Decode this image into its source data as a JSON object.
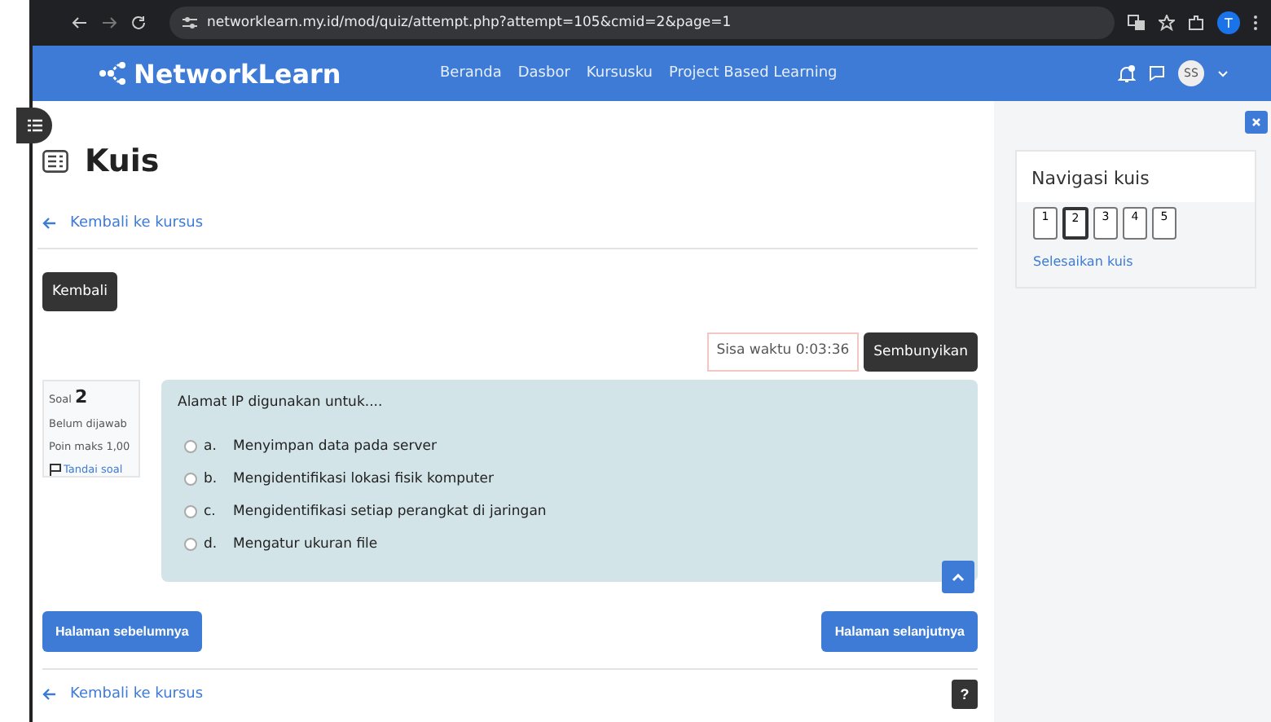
{
  "browser": {
    "url": "networklearn.my.id/mod/quiz/attempt.php?attempt=105&cmid=2&page=1",
    "profile": "T"
  },
  "navbar": {
    "brand": "NetworkLearn",
    "links": [
      "Beranda",
      "Dasbor",
      "Kursusku",
      "Project Based Learning"
    ],
    "avatar": "SS"
  },
  "page": {
    "title": "Kuis",
    "back_link": "Kembali ke kursus",
    "back_button": "Kembali",
    "timer": "Sisa waktu 0:03:36",
    "hide_button": "Sembunyikan"
  },
  "question": {
    "label": "Soal",
    "number": "2",
    "status": "Belum dijawab",
    "points": "Poin maks 1,00",
    "flag": "Tandai soal",
    "text": "Alamat IP digunakan untuk....",
    "options": [
      {
        "letter": "a.",
        "text": "Menyimpan data pada server",
        "selected": false
      },
      {
        "letter": "b.",
        "text": "Mengidentifikasi lokasi fisik komputer",
        "selected": false
      },
      {
        "letter": "c.",
        "text": "Mengidentifikasi setiap perangkat di jaringan",
        "selected": false
      },
      {
        "letter": "d.",
        "text": "Mengatur ukuran file",
        "selected": false
      }
    ]
  },
  "footer": {
    "prev": "Halaman sebelumnya",
    "next": "Halaman selanjutnya",
    "back_link": "Kembali ke kursus",
    "help": "?"
  },
  "drawer": {
    "title": "Navigasi kuis",
    "pages": [
      {
        "label": "1",
        "selected": false
      },
      {
        "label": "2",
        "selected": true
      },
      {
        "label": "3",
        "selected": false
      },
      {
        "label": "4",
        "selected": false
      },
      {
        "label": "5",
        "selected": false
      }
    ],
    "finish": "Selesaikan kuis"
  }
}
